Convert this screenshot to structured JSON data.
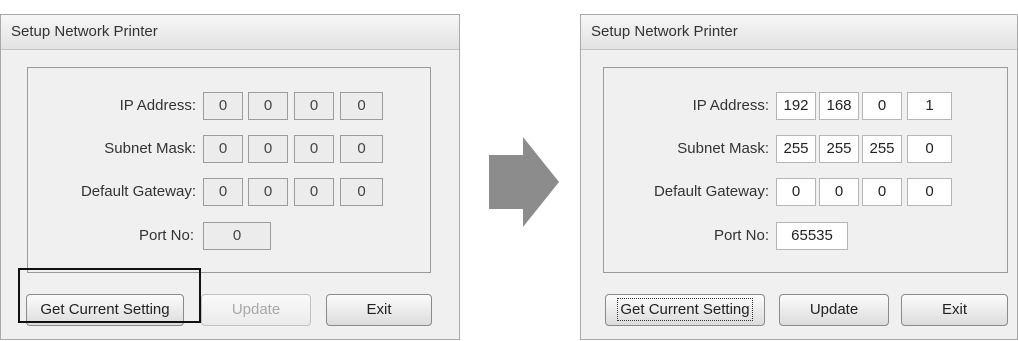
{
  "before": {
    "title": "Setup Network Printer",
    "labels": {
      "ip": "IP Address:",
      "subnet": "Subnet Mask:",
      "gateway": "Default Gateway:",
      "port": "Port No:"
    },
    "ip": [
      "0",
      "0",
      "0",
      "0"
    ],
    "subnet": [
      "0",
      "0",
      "0",
      "0"
    ],
    "gateway": [
      "0",
      "0",
      "0",
      "0"
    ],
    "port": "0",
    "buttons": {
      "get": "Get Current Setting",
      "update": "Update",
      "exit": "Exit"
    },
    "update_enabled": false,
    "get_button_highlighted": true
  },
  "after": {
    "title": "Setup Network Printer",
    "labels": {
      "ip": "IP Address:",
      "subnet": "Subnet Mask:",
      "gateway": "Default Gateway:",
      "port": "Port No:"
    },
    "ip": [
      "192",
      "168",
      "0",
      "1"
    ],
    "subnet": [
      "255",
      "255",
      "255",
      "0"
    ],
    "gateway": [
      "0",
      "0",
      "0",
      "0"
    ],
    "port": "65535",
    "buttons": {
      "get": "Get Current Setting",
      "update": "Update",
      "exit": "Exit"
    },
    "update_enabled": true
  },
  "colors": {
    "arrow": "#8c8c8c",
    "window_bg": "#f0f0f0"
  },
  "icons": {
    "transition": "right-arrow-icon"
  }
}
